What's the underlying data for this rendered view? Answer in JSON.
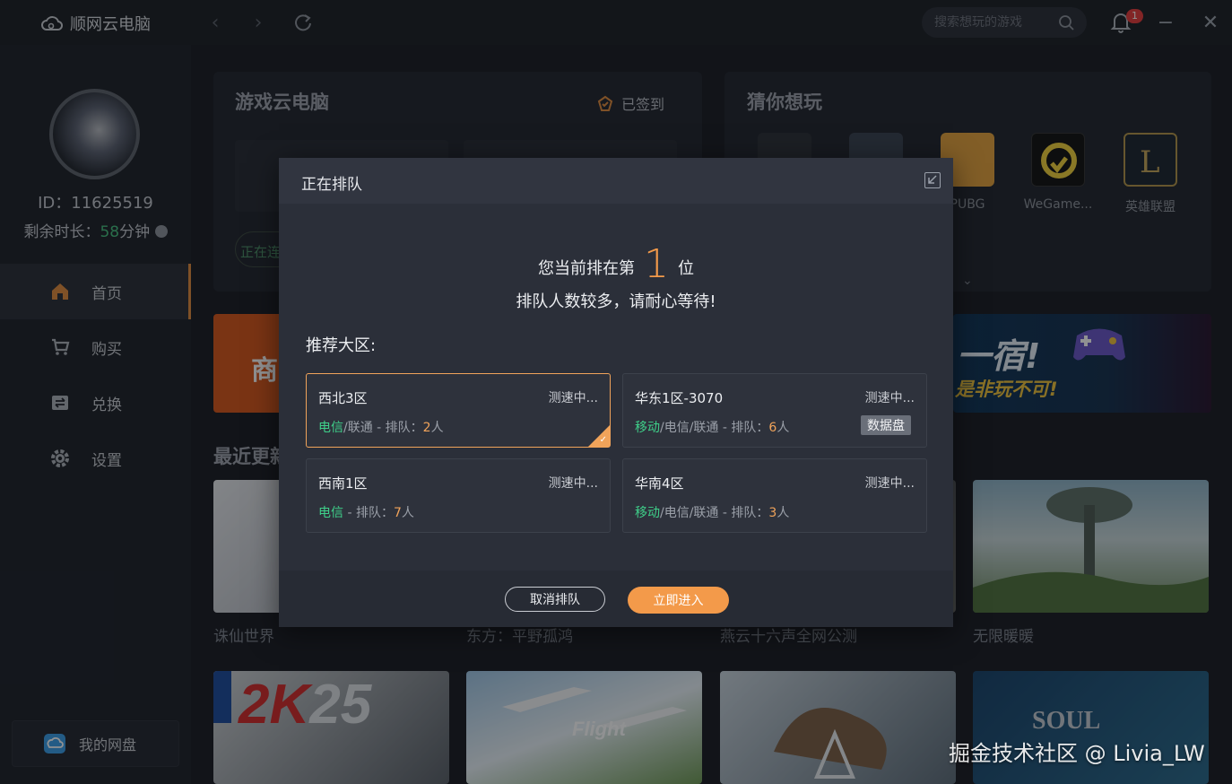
{
  "app": {
    "title": "顺网云电脑"
  },
  "search": {
    "placeholder": "搜索想玩的游戏"
  },
  "notifications": {
    "count": "1"
  },
  "user": {
    "id_label": "ID：11625519",
    "remain_prefix": "剩余时长：",
    "remain_minutes": "58",
    "remain_unit": "分钟"
  },
  "sidebar": {
    "items": [
      {
        "label": "首页",
        "icon": "home-icon"
      },
      {
        "label": "购买",
        "icon": "cart-icon"
      },
      {
        "label": "兑换",
        "icon": "exchange-icon"
      },
      {
        "label": "设置",
        "icon": "gear-icon"
      }
    ],
    "disk_label": "我的网盘"
  },
  "main": {
    "cloud_title": "游戏云电脑",
    "signin_label": "已签到",
    "connecting_label": "正在连",
    "guess_title": "猜你想玩",
    "games": [
      {
        "label": ""
      },
      {
        "label": ""
      },
      {
        "label": "PUBG"
      },
      {
        "label": "WeGame..."
      },
      {
        "label": "英雄联盟"
      }
    ],
    "recent_title": "最近更新",
    "banner_text": "商",
    "banner_right_text_1": "一宿!",
    "banner_right_text_2": "是非玩不可!",
    "cards_row1": [
      {
        "label": "诛仙世界"
      },
      {
        "label": "东方：平野孤鸿"
      },
      {
        "label": "燕云十六声全网公测"
      },
      {
        "label": "无限暖暖"
      }
    ]
  },
  "dialog": {
    "title": "正在排队",
    "rank_prefix": "您当前排在第",
    "rank_number": "1",
    "rank_suffix": "位",
    "wait_text": "排队人数较多，请耐心等待!",
    "recommend_title": "推荐大区:",
    "zones": [
      {
        "name": "西北3区",
        "speed": "测速中...",
        "isp_primary": "电信",
        "isp_rest": "/联通 - 排队：",
        "count": "2",
        "unit": "人",
        "tag": ""
      },
      {
        "name": "华东1区-3070",
        "speed": "测速中...",
        "isp_primary": "移动",
        "isp_rest": "/电信/联通 - 排队：",
        "count": "6",
        "unit": "人",
        "tag": "数据盘"
      },
      {
        "name": "西南1区",
        "speed": "测速中...",
        "isp_primary": "电信",
        "isp_rest": " - 排队：",
        "count": "7",
        "unit": "人",
        "tag": ""
      },
      {
        "name": "华南4区",
        "speed": "测速中...",
        "isp_primary": "移动",
        "isp_rest": "/电信/联通 - 排队：",
        "count": "3",
        "unit": "人",
        "tag": ""
      }
    ],
    "cancel_label": "取消排队",
    "enter_label": "立即进入"
  },
  "watermark": "掘金技术社区 @ Livia_LW",
  "colors": {
    "accent": "#f39a4a",
    "isp_green": "#3fd08a"
  }
}
